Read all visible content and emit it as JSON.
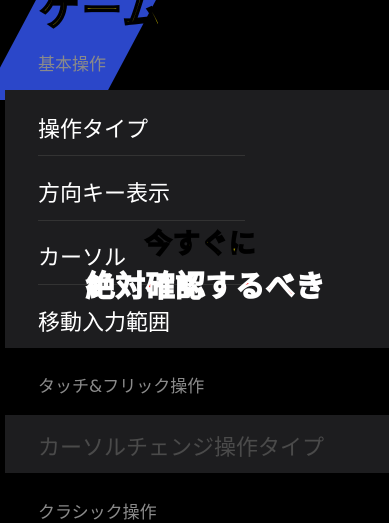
{
  "title": {
    "text": "ゲーム環境"
  },
  "sections": {
    "basic_header": "基本操作",
    "basic_items": [
      "操作タイプ",
      "方向キー表示",
      "カーソル",
      "移動入力範囲"
    ],
    "touch_header": "タッチ&フリック操作",
    "touch_disabled_item": "カーソルチェンジ操作タイプ",
    "classic_header": "クラシック操作"
  },
  "overlay": {
    "line1": "今すぐに",
    "line2": "絶対確認するべき"
  },
  "colors": {
    "title_yellow": "#ffe600",
    "stripe_blue": "#2b47c9",
    "overlay_red": "#ff2222"
  }
}
